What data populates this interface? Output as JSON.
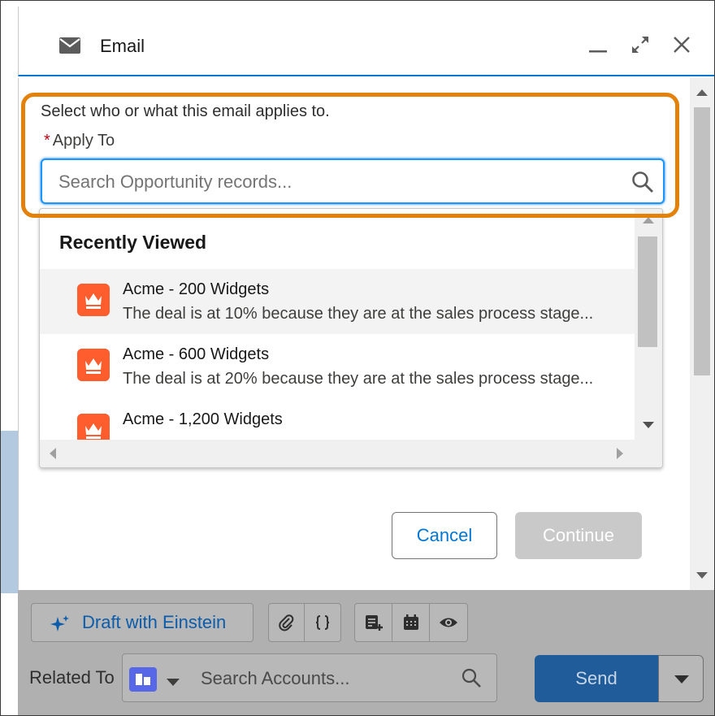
{
  "header": {
    "title": "Email",
    "icon": "mail-icon",
    "minimize_icon": "minimize-icon",
    "expand_icon": "expand-icon",
    "close_icon": "close-icon"
  },
  "form": {
    "hint": "Select who or what this email applies to.",
    "required_marker": "*",
    "field_label": "Apply To",
    "search_placeholder": "Search Opportunity records...",
    "search_value": ""
  },
  "dropdown": {
    "heading": "Recently Viewed",
    "items": [
      {
        "name": "Acme - 200 Widgets",
        "description": "The deal is at 10% because they are at the sales process stage...",
        "icon": "opportunity-icon",
        "selected": true
      },
      {
        "name": "Acme - 600 Widgets",
        "description": "The deal is at 20% because they are at the sales process stage...",
        "icon": "opportunity-icon",
        "selected": false
      },
      {
        "name": "Acme - 1,200 Widgets",
        "description": "",
        "icon": "opportunity-icon",
        "selected": false
      }
    ]
  },
  "buttons": {
    "cancel": "Cancel",
    "continue": "Continue"
  },
  "composer": {
    "draft_label": "Draft with Einstein",
    "related_label": "Related To",
    "related_placeholder": "Search Accounts...",
    "send_label": "Send"
  },
  "colors": {
    "highlight": "#e4810a",
    "brand_blue": "#0176d3",
    "opportunity_icon": "#ff5d2d",
    "account_icon": "#5867e8",
    "send_button": "#1f5c99"
  }
}
